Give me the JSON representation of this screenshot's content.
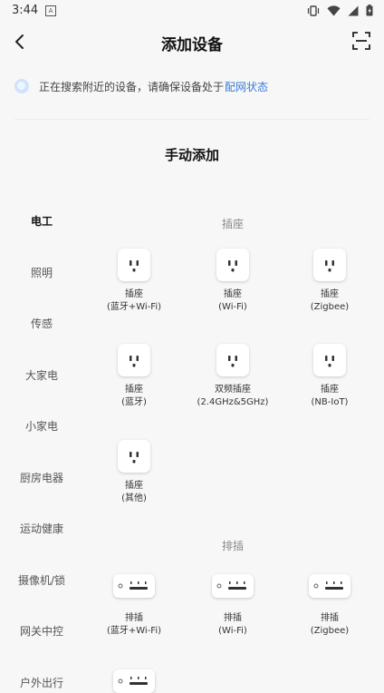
{
  "status_bar": {
    "time": "3:44",
    "notif_glyph": "A"
  },
  "header": {
    "title": "添加设备"
  },
  "search_tip": {
    "text": "正在搜索附近的设备，请确保设备处于",
    "link": "配网状态"
  },
  "section": {
    "title": "手动添加"
  },
  "sidebar": {
    "items": [
      {
        "label": "电工",
        "active": true
      },
      {
        "label": "照明"
      },
      {
        "label": "传感"
      },
      {
        "label": "大家电"
      },
      {
        "label": "小家电"
      },
      {
        "label": "厨房电器"
      },
      {
        "label": "运动健康"
      },
      {
        "label": "摄像机/锁"
      },
      {
        "label": "网关中控"
      },
      {
        "label": "户外出行"
      }
    ]
  },
  "categories": [
    {
      "title": "插座",
      "devices": [
        {
          "name": "插座",
          "sub": "(蓝牙+Wi-Fi)"
        },
        {
          "name": "插座",
          "sub": "(Wi-Fi)"
        },
        {
          "name": "插座",
          "sub": "(Zigbee)"
        },
        {
          "name": "插座",
          "sub": "(蓝牙)"
        },
        {
          "name": "双频插座",
          "sub": "(2.4GHz&5GHz)"
        },
        {
          "name": "插座",
          "sub": "(NB-IoT)"
        },
        {
          "name": "插座",
          "sub": "(其他)"
        }
      ]
    },
    {
      "title": "排插",
      "devices": [
        {
          "name": "排插",
          "sub": "(蓝牙+Wi-Fi)"
        },
        {
          "name": "排插",
          "sub": "(Wi-Fi)"
        },
        {
          "name": "排插",
          "sub": "(Zigbee)"
        }
      ]
    }
  ],
  "colors": {
    "accent": "#3a7bd5",
    "background": "#f7f7f8"
  },
  "icons": {
    "back": "chevron-left-icon",
    "scan": "scan-icon",
    "socket": "socket-icon",
    "strip": "power-strip-icon"
  }
}
